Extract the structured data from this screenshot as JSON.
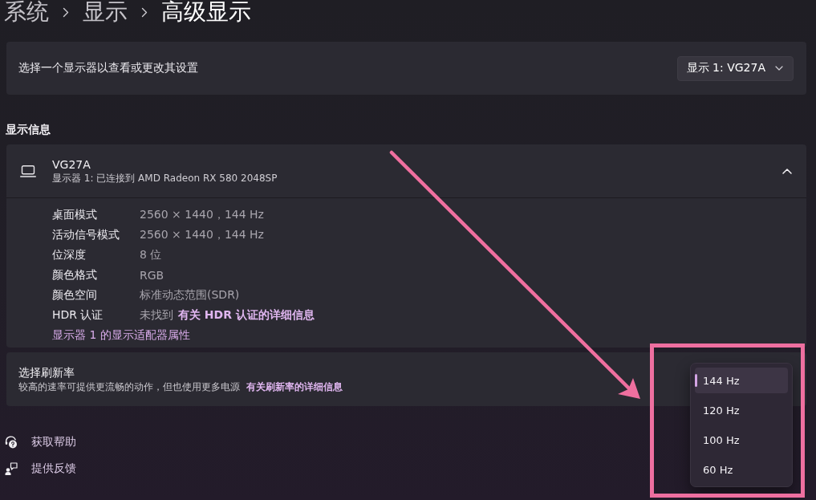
{
  "breadcrumb": [
    {
      "label": "系统",
      "current": false
    },
    {
      "label": "显示",
      "current": false
    },
    {
      "label": "高级显示",
      "current": true
    }
  ],
  "display_picker": {
    "label": "选择一个显示器以查看或更改其设置",
    "value": "显示 1: VG27A"
  },
  "display_info": {
    "heading": "显示信息",
    "name": "VG27A",
    "subtitle": "显示器 1: 已连接到 AMD Radeon RX 580 2048SP",
    "expanded": true,
    "rows": [
      {
        "label": "桌面模式",
        "value": "2560 × 1440，144 Hz"
      },
      {
        "label": "活动信号模式",
        "value": "2560 × 1440，144 Hz"
      },
      {
        "label": "位深度",
        "value": "8 位"
      },
      {
        "label": "颜色格式",
        "value": "RGB"
      },
      {
        "label": "颜色空间",
        "value": "标准动态范围(SDR)"
      },
      {
        "label": "HDR 认证",
        "value": "未找到",
        "link": "有关 HDR 认证的详细信息"
      }
    ],
    "adapter_link": "显示器 1 的显示适配器属性"
  },
  "refresh_rate": {
    "title": "选择刷新率",
    "description": "较高的速率可提供更流畅的动作，但也使用更多电源",
    "link": "有关刷新率的详细信息",
    "options": [
      {
        "label": "144 Hz",
        "selected": true
      },
      {
        "label": "120 Hz",
        "selected": false
      },
      {
        "label": "100 Hz",
        "selected": false
      },
      {
        "label": "60 Hz",
        "selected": false
      }
    ]
  },
  "footer_links": [
    {
      "kind": "help",
      "label": "获取帮助"
    },
    {
      "kind": "feedback",
      "label": "提供反馈"
    }
  ],
  "markup": {
    "arrow": true,
    "frame": true
  }
}
